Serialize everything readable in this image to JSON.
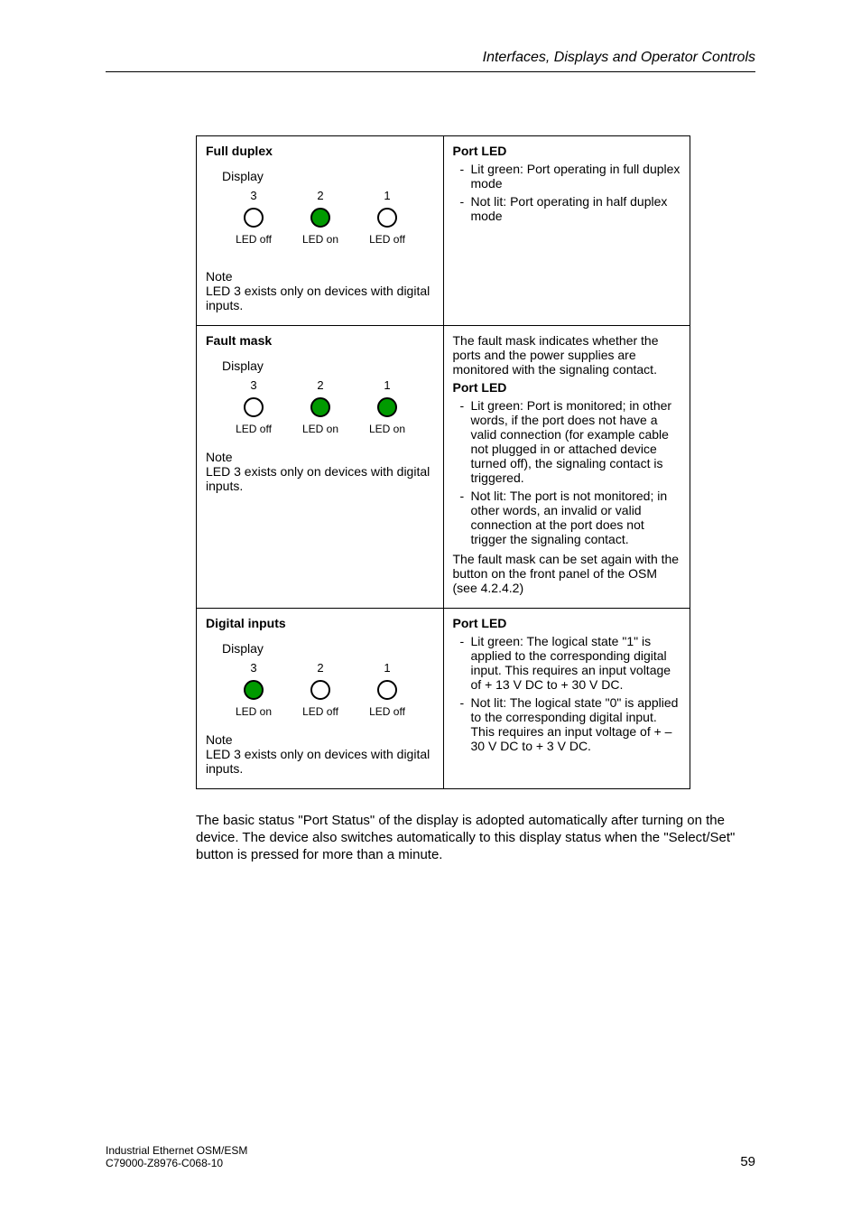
{
  "header": {
    "section": "Interfaces, Displays and Operator Controls"
  },
  "labels": {
    "display": "Display",
    "led_on": "LED on",
    "led_off": "LED off"
  },
  "rows": {
    "full_duplex": {
      "title": "Full duplex",
      "leds": [
        {
          "num": "3",
          "state": "off"
        },
        {
          "num": "2",
          "state": "on"
        },
        {
          "num": "1",
          "state": "off"
        }
      ],
      "note_label": "Note",
      "note_text": "LED 3 exists only on devices with digital inputs.",
      "right_title": "Port LED",
      "right_items": [
        "Lit green: Port operating in full duplex mode",
        "Not lit: Port operating in half duplex mode"
      ]
    },
    "fault_mask": {
      "title": "Fault mask",
      "leds": [
        {
          "num": "3",
          "state": "off"
        },
        {
          "num": "2",
          "state": "on"
        },
        {
          "num": "1",
          "state": "on"
        }
      ],
      "note_label": "Note",
      "note_text": "LED 3 exists only on devices with digital inputs.",
      "right_intro": "The fault mask indicates whether the ports and the power supplies are monitored with the signaling contact.",
      "right_title": "Port LED",
      "right_items": [
        "Lit green: Port is monitored; in other words, if the port does not have a valid connection (for example cable not plugged in or attached device turned off), the signaling contact is triggered.",
        "Not lit: The port is not monitored; in other words, an invalid or valid connection at the port does not trigger the signaling contact."
      ],
      "right_footer": "The fault mask can be set again with the button on the front panel of the OSM (see 4.2.4.2)"
    },
    "digital_inputs": {
      "title": "Digital inputs",
      "leds": [
        {
          "num": "3",
          "state": "on"
        },
        {
          "num": "2",
          "state": "off"
        },
        {
          "num": "1",
          "state": "off"
        }
      ],
      "note_label": "Note",
      "note_text": "LED 3 exists only on devices with digital inputs.",
      "right_title": "Port LED",
      "right_items": [
        "Lit green: The logical state \"1\" is applied to the corresponding digital input. This requires an input voltage of + 13 V DC to + 30 V DC.",
        "Not lit: The logical state \"0\" is applied to the corresponding digital input. This requires an input voltage of + –30 V DC to + 3 V DC."
      ]
    }
  },
  "body_para": "The basic status \"Port Status\" of the display is adopted automatically after turning on the device. The device also switches automatically to this display status when the \"Select/Set\" button is pressed for more than a minute.",
  "footer": {
    "line1": "Industrial Ethernet OSM/ESM",
    "line2": "C79000-Z8976-C068-10",
    "page": "59"
  }
}
